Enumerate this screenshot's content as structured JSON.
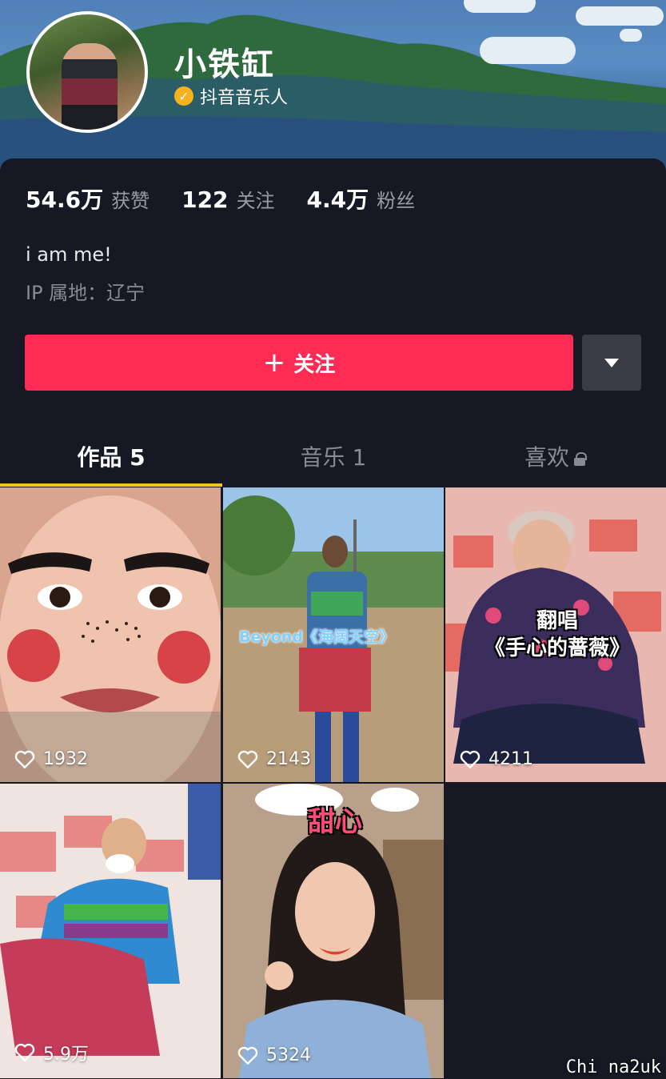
{
  "profile": {
    "name": "小铁缸",
    "verified_label": "抖音音乐人",
    "verify_icon": "check-badge-icon",
    "bio": "i am me!",
    "ip_location": "IP 属地：辽宁"
  },
  "stats": [
    {
      "value": "54.6万",
      "label": "获赞"
    },
    {
      "value": "122",
      "label": "关注"
    },
    {
      "value": "4.4万",
      "label": "粉丝"
    }
  ],
  "actions": {
    "follow_plus": "+",
    "follow_label": "关注",
    "more_icon": "caret-down-icon"
  },
  "tabs": [
    {
      "label": "作品 5",
      "active": true
    },
    {
      "label": "音乐 1",
      "active": false
    },
    {
      "label": "喜欢",
      "active": false,
      "locked": true
    }
  ],
  "videos": [
    {
      "likes": "1932",
      "overlay": ""
    },
    {
      "likes": "2143",
      "overlay": "Beyond《海阔天空》"
    },
    {
      "likes": "4211",
      "overlay": "翻唱\n《手心的蔷薇》"
    },
    {
      "likes": "5.9万",
      "overlay": ""
    },
    {
      "likes": "5324",
      "overlay": "甜心"
    }
  ],
  "colors": {
    "accent": "#fe2c55",
    "background": "#161823",
    "tab_indicator": "#f5c518",
    "verify_badge": "#f5b21c"
  },
  "watermark": "Chi na2uk"
}
